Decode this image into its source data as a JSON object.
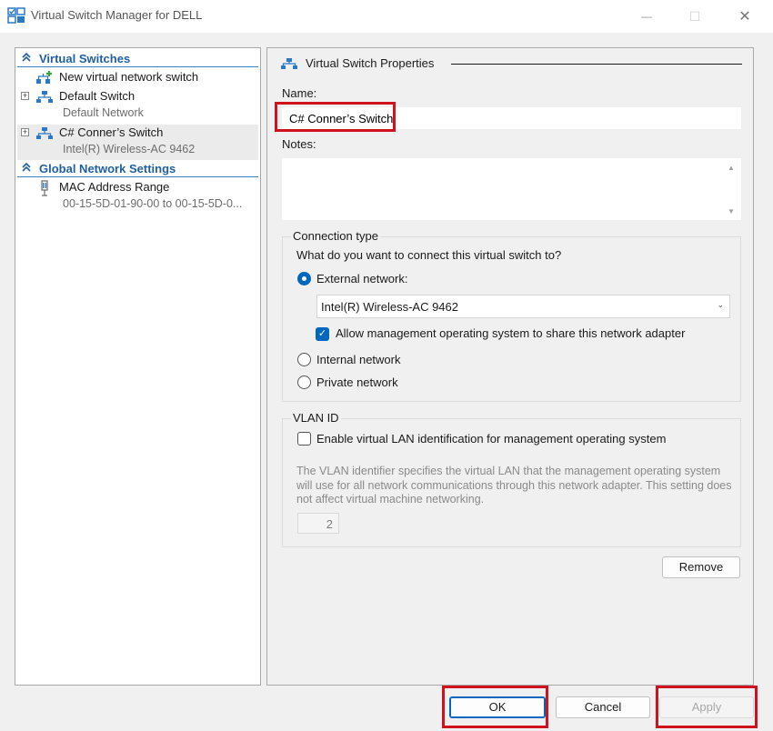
{
  "window": {
    "title": "Virtual Switch Manager for DELL",
    "minimize_glyph": "—",
    "maximize_glyph": "☐",
    "close_glyph": "✕"
  },
  "sidebar": {
    "virtual_switches_header": "Virtual Switches",
    "items": [
      {
        "label": "New virtual network switch",
        "sublabel": "",
        "icon": "new-switch-icon"
      },
      {
        "label": "Default Switch",
        "sublabel": "Default Network",
        "icon": "network-switch-icon"
      },
      {
        "label": "C# Conner’s Switch",
        "sublabel": "Intel(R) Wireless-AC 9462",
        "icon": "network-switch-icon",
        "selected": true
      }
    ],
    "global_header": "Global Network Settings",
    "global_items": [
      {
        "label": "MAC Address Range",
        "sublabel": "00-15-5D-01-90-00 to 00-15-5D-0...",
        "icon": "mac-address-icon"
      }
    ]
  },
  "properties": {
    "header": "Virtual Switch Properties",
    "name_label": "Name:",
    "name_value": "C# Conner’s Switch",
    "notes_label": "Notes:",
    "notes_value": "",
    "connection_type": {
      "title": "Connection type",
      "question": "What do you want to connect this virtual switch to?",
      "external_label": "External network:",
      "adapter_selected": "Intel(R) Wireless-AC 9462",
      "allow_mgmt_label": "Allow management operating system to share this network adapter",
      "allow_mgmt_checked": true,
      "internal_label": "Internal network",
      "private_label": "Private network",
      "selected": "external"
    },
    "vlan": {
      "title": "VLAN ID",
      "enable_label": "Enable virtual LAN identification for management operating system",
      "enable_checked": false,
      "description": "The VLAN identifier specifies the virtual LAN that the management operating system will use for all network communications through this network adapter. This setting does not affect virtual machine networking.",
      "value": "2"
    },
    "remove_label": "Remove"
  },
  "footer": {
    "ok_label": "OK",
    "cancel_label": "Cancel",
    "apply_label": "Apply"
  },
  "colors": {
    "accent": "#0067c0",
    "header_blue": "#1f5fa6",
    "highlight_red": "#d0121c"
  }
}
